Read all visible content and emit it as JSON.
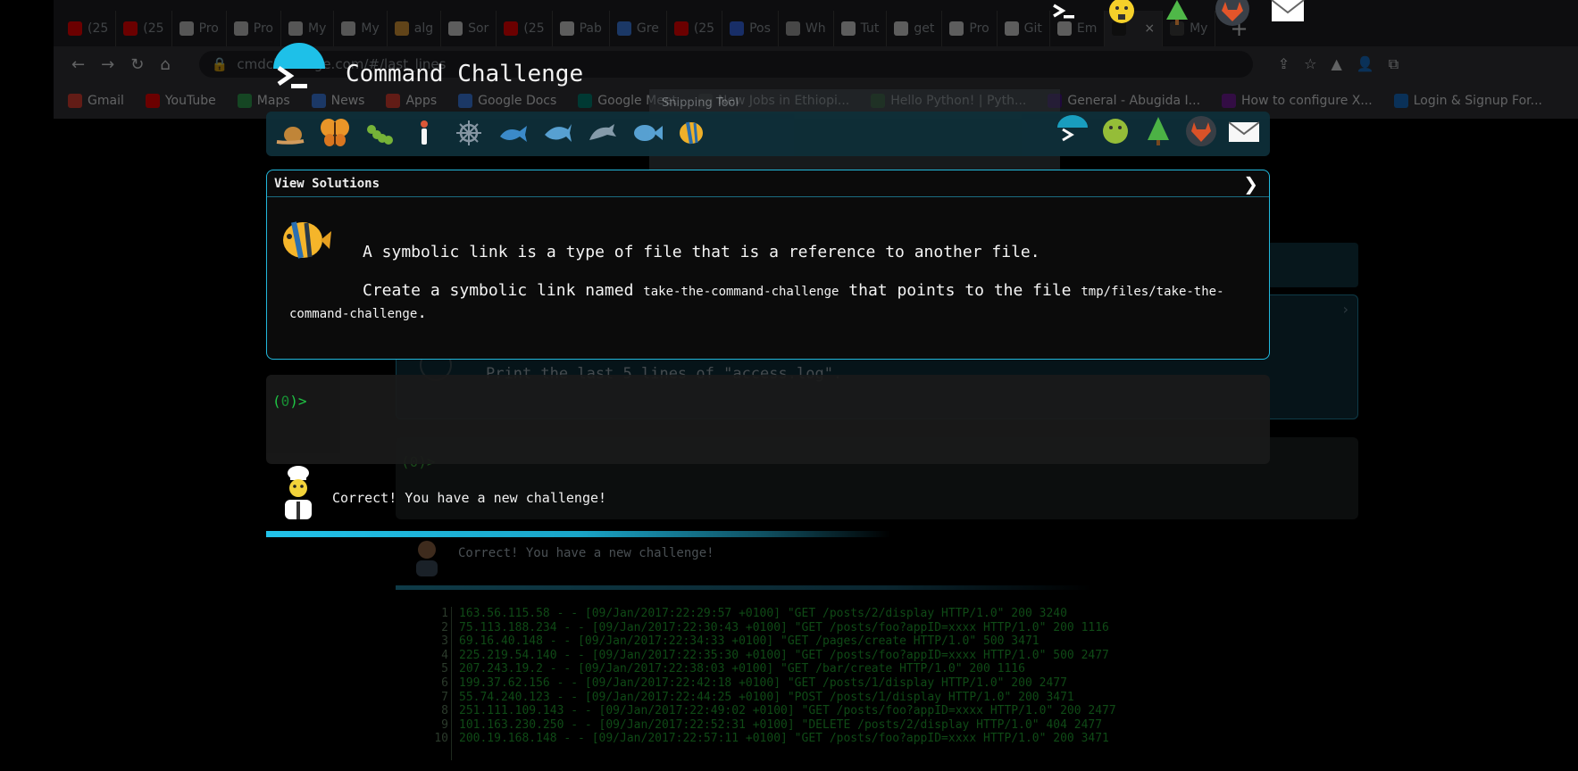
{
  "browser": {
    "tabs": [
      {
        "label": "(25",
        "color": "#ff0000"
      },
      {
        "label": "(25",
        "color": "#ff0000"
      },
      {
        "label": "Pro",
        "color": "#cccccc"
      },
      {
        "label": "Pro",
        "color": "#cccccc"
      },
      {
        "label": "My",
        "color": "#cccccc"
      },
      {
        "label": "My",
        "color": "#cccccc"
      },
      {
        "label": "alg",
        "color": "#e8a33d"
      },
      {
        "label": "Sor",
        "color": "#dddddd"
      },
      {
        "label": "(25",
        "color": "#ff0000"
      },
      {
        "label": "Pab",
        "color": "#dddddd"
      },
      {
        "label": "Gre",
        "color": "#4285f4"
      },
      {
        "label": "(25",
        "color": "#ff0000"
      },
      {
        "label": "Pos",
        "color": "#3b6ef5"
      },
      {
        "label": "Wh",
        "color": "#aaaaaa"
      },
      {
        "label": "Tut",
        "color": "#dddddd"
      },
      {
        "label": "get",
        "color": "#dddddd"
      },
      {
        "label": "Pro",
        "color": "#dddddd"
      },
      {
        "label": "Git",
        "color": "#dddddd"
      },
      {
        "label": "Em",
        "color": "#dddddd"
      }
    ],
    "active_tab": {
      "label": "",
      "close": "×"
    },
    "last_tab": {
      "label": "My"
    },
    "new_tab": "+",
    "url": "cmdchallenge.com/#/last_lines",
    "bookmarks": [
      {
        "label": "Gmail",
        "color": "#ea4335"
      },
      {
        "label": "YouTube",
        "color": "#ff0000"
      },
      {
        "label": "Maps",
        "color": "#34a853"
      },
      {
        "label": "News",
        "color": "#4285f4"
      },
      {
        "label": "Apps",
        "color": "#ea4335"
      },
      {
        "label": "Google Docs",
        "color": "#4285f4"
      },
      {
        "label": "Google Meet",
        "color": "#00897b"
      },
      {
        "label": "New Jobs in Ethiopi...",
        "color": "#555555"
      },
      {
        "label": "Hello Python! | Pyth...",
        "color": "#2e7d32"
      },
      {
        "label": "General - Abugida I...",
        "color": "#4a148c"
      },
      {
        "label": "How to configure X...",
        "color": "#7b1fa2"
      },
      {
        "label": "Login & Signup For...",
        "color": "#1976d2"
      }
    ]
  },
  "snipping_tool": {
    "label": "Snipping Tool"
  },
  "ghost_page": {
    "title": "Command Challenge",
    "view_solutions": "View Solutions",
    "task": "Print the last 5 lines of \"access.log\".",
    "prompt": "(0)>",
    "message": "Correct! You have a new challenge!",
    "log_lines": [
      "163.56.115.58 - - [09/Jan/2017:22:29:57 +0100] \"GET /posts/2/display HTTP/1.0\" 200 3240",
      "75.113.188.234 - - [09/Jan/2017:22:30:43 +0100] \"GET /posts/foo?appID=xxxx HTTP/1.0\" 200 1116",
      "69.16.40.148 - - [09/Jan/2017:22:34:33 +0100] \"GET /pages/create HTTP/1.0\" 500 3471",
      "225.219.54.140 - - [09/Jan/2017:22:35:30 +0100] \"GET /posts/foo?appID=xxxx HTTP/1.0\" 500 2477",
      "207.243.19.2 - - [09/Jan/2017:22:38:03 +0100] \"GET /bar/create HTTP/1.0\" 200 1116",
      "199.37.62.156 - - [09/Jan/2017:22:42:18 +0100] \"GET /posts/1/display HTTP/1.0\" 200 2477",
      "55.74.240.123 - - [09/Jan/2017:22:44:25 +0100] \"POST /posts/1/display HTTP/1.0\" 200 3471",
      "251.111.109.143 - - [09/Jan/2017:22:49:02 +0100] \"GET /posts/foo?appID=xxxx HTTP/1.0\" 200 2477",
      "101.163.230.250 - - [09/Jan/2017:22:52:31 +0100] \"DELETE /posts/2/display HTTP/1.0\" 404 2477",
      "200.19.168.148 - - [09/Jan/2017:22:57:11 +0100] \"GET /posts/foo?appID=xxxx HTTP/1.0\" 200 3471"
    ]
  },
  "app": {
    "title": "Command Challenge",
    "view_solutions": "View Solutions",
    "chevron": "❯",
    "task_intro": "A symbolic link is a type of file that is a reference to another file.",
    "task_part1": "Create a symbolic link named ",
    "task_code1": "take-the-command-challenge",
    "task_part2": " that points to the file ",
    "task_code2": "tmp/files/take-the-command-challenge",
    "task_part3": ".",
    "prompt_open": "(",
    "prompt_count": "0",
    "prompt_close": ")>",
    "message": "Correct! You have a new challenge!",
    "progress_fraction": 0.55,
    "nav_icons": [
      "snail-icon",
      "butterfly-icon",
      "caterpillar-icon",
      "figure-icon",
      "ship-wheel-icon",
      "whale-icon",
      "shark-icon",
      "dolphin-icon",
      "fish-icon",
      "tropical-fish-icon"
    ],
    "nav_right_icons": [
      "cmd-logo-icon",
      "emoji-icon",
      "tree-icon",
      "gitlab-icon",
      "mail-icon"
    ]
  },
  "colors": {
    "accent": "#22b8dc",
    "prompt_green": "#22d64a"
  }
}
